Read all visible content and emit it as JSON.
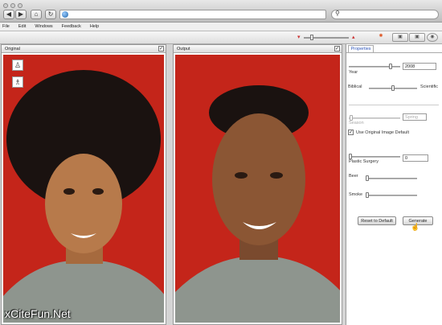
{
  "menu": [
    "File",
    "Edit",
    "Windows",
    "Feedback",
    "Help"
  ],
  "panels": {
    "original": "Original",
    "output": "Output"
  },
  "properties": {
    "tab": "Properties",
    "year_label": "Year",
    "year_value": "2008",
    "biblical": "Biblical",
    "scientific": "Scientific",
    "season_label": "Season",
    "season_value": "Spring",
    "use_original": "Use Original Image Default",
    "plastic_label": "Plastic Surgery",
    "plastic_value": "0",
    "beer": "Beer",
    "smoke": "Smoke",
    "reset": "Reset to Default",
    "generate": "Generate"
  },
  "watermark": "xCiteFun.Net",
  "icons": [
    "back-icon",
    "forward-icon",
    "home-icon",
    "reload-icon",
    "globe-icon",
    "search-icon",
    "face-icon",
    "user-icon",
    "person-icon"
  ],
  "colors": {
    "accent": "#2c53b8",
    "photo_bg": "#c4251a"
  }
}
